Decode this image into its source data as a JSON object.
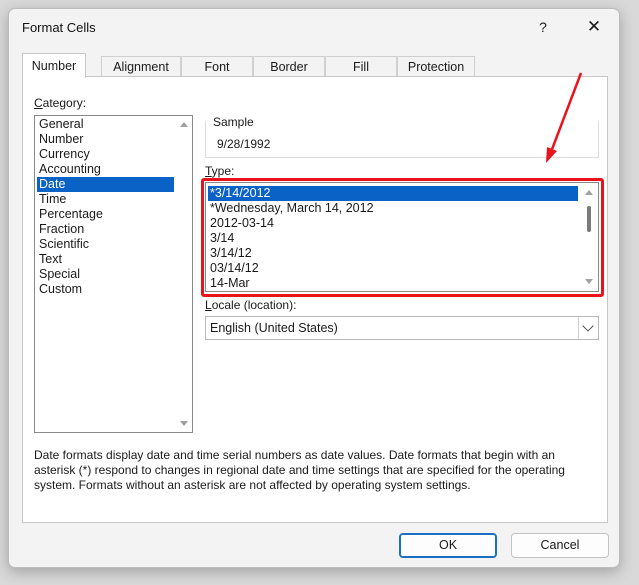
{
  "dialog": {
    "title": "Format Cells",
    "help_glyph": "?",
    "close_glyph": "✕"
  },
  "tabs": [
    {
      "label": "Number",
      "active": true
    },
    {
      "label": "Alignment",
      "active": false
    },
    {
      "label": "Font",
      "active": false
    },
    {
      "label": "Border",
      "active": false
    },
    {
      "label": "Fill",
      "active": false
    },
    {
      "label": "Protection",
      "active": false
    }
  ],
  "category": {
    "label_prefix": "C",
    "label_rest": "ategory:",
    "items": [
      "General",
      "Number",
      "Currency",
      "Accounting",
      "Date",
      "Time",
      "Percentage",
      "Fraction",
      "Scientific",
      "Text",
      "Special",
      "Custom"
    ],
    "selected": "Date"
  },
  "sample": {
    "label": "Sample",
    "value": "9/28/1992"
  },
  "type": {
    "label_prefix": "T",
    "label_rest": "ype:",
    "items": [
      "*3/14/2012",
      "*Wednesday, March 14, 2012",
      "2012-03-14",
      "3/14",
      "3/14/12",
      "03/14/12",
      "14-Mar"
    ],
    "selected": "*3/14/2012"
  },
  "locale": {
    "label_prefix": "L",
    "label_rest": "ocale (location):",
    "value": "English (United States)"
  },
  "description": "Date formats display date and time serial numbers as date values.  Date formats that begin with an asterisk (*) respond to changes in regional date and time settings that are specified for the operating system. Formats without an asterisk are not affected by operating system settings.",
  "buttons": {
    "ok": "OK",
    "cancel": "Cancel"
  },
  "annotation": {
    "color": "#e8131b"
  }
}
